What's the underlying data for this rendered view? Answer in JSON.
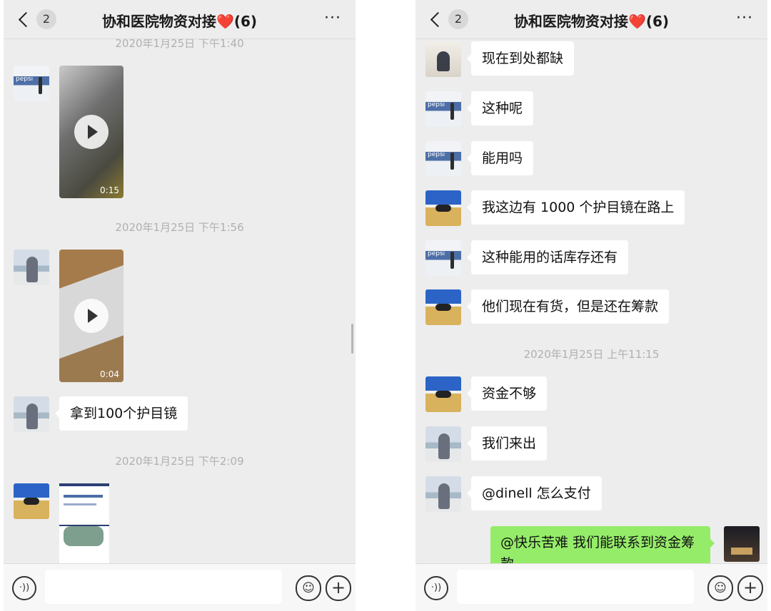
{
  "chat": {
    "title": "协和医院物资对接",
    "heart": "❤️",
    "member_count": "(6)",
    "back_badge": "2",
    "more_label": "···"
  },
  "left": {
    "times": [
      "2020年1月25日 下午1:40",
      "2020年1月25日 下午1:56",
      "2020年1月25日 下午2:09"
    ],
    "videos": [
      {
        "sender": "pepsi-avatar",
        "duration": "0:15"
      },
      {
        "sender": "girls-avatar",
        "duration": "0:04"
      }
    ],
    "messages": [
      {
        "sender": "girls-avatar",
        "text": "拿到100个护目镜"
      }
    ],
    "image": {
      "sender": "bison-avatar"
    }
  },
  "right": {
    "messages": [
      {
        "sender": "man-avatar",
        "text": "现在到处都缺"
      },
      {
        "sender": "pepsi-avatar",
        "text": "这种呢"
      },
      {
        "sender": "pepsi-avatar",
        "text": "能用吗"
      },
      {
        "sender": "bison-avatar",
        "text": "我这边有 1000 个护目镜在路上"
      },
      {
        "sender": "pepsi-avatar",
        "text": "这种能用的话库存还有"
      },
      {
        "sender": "bison-avatar",
        "text": "他们现在有货，但是还在筹款"
      }
    ],
    "time": "2020年1月25日 上午11:15",
    "messages2": [
      {
        "sender": "bison-avatar",
        "text": "资金不够"
      },
      {
        "sender": "girls-avatar",
        "text": "我们来出"
      },
      {
        "sender": "girls-avatar",
        "text": "@dinell 怎么支付"
      }
    ],
    "own_message": "@快乐苦难 我们能联系到资金筹款"
  },
  "input": {
    "voice_icon": "·))",
    "emoji_icon": "☺",
    "plus_icon": "+",
    "placeholder": ""
  },
  "colors": {
    "background": "#ededed",
    "own_bubble": "#95ec69",
    "heart": "#e02929"
  },
  "icons": [
    "back-chevron-icon",
    "more-icon",
    "voice-icon",
    "emoji-icon",
    "plus-icon",
    "play-icon"
  ]
}
